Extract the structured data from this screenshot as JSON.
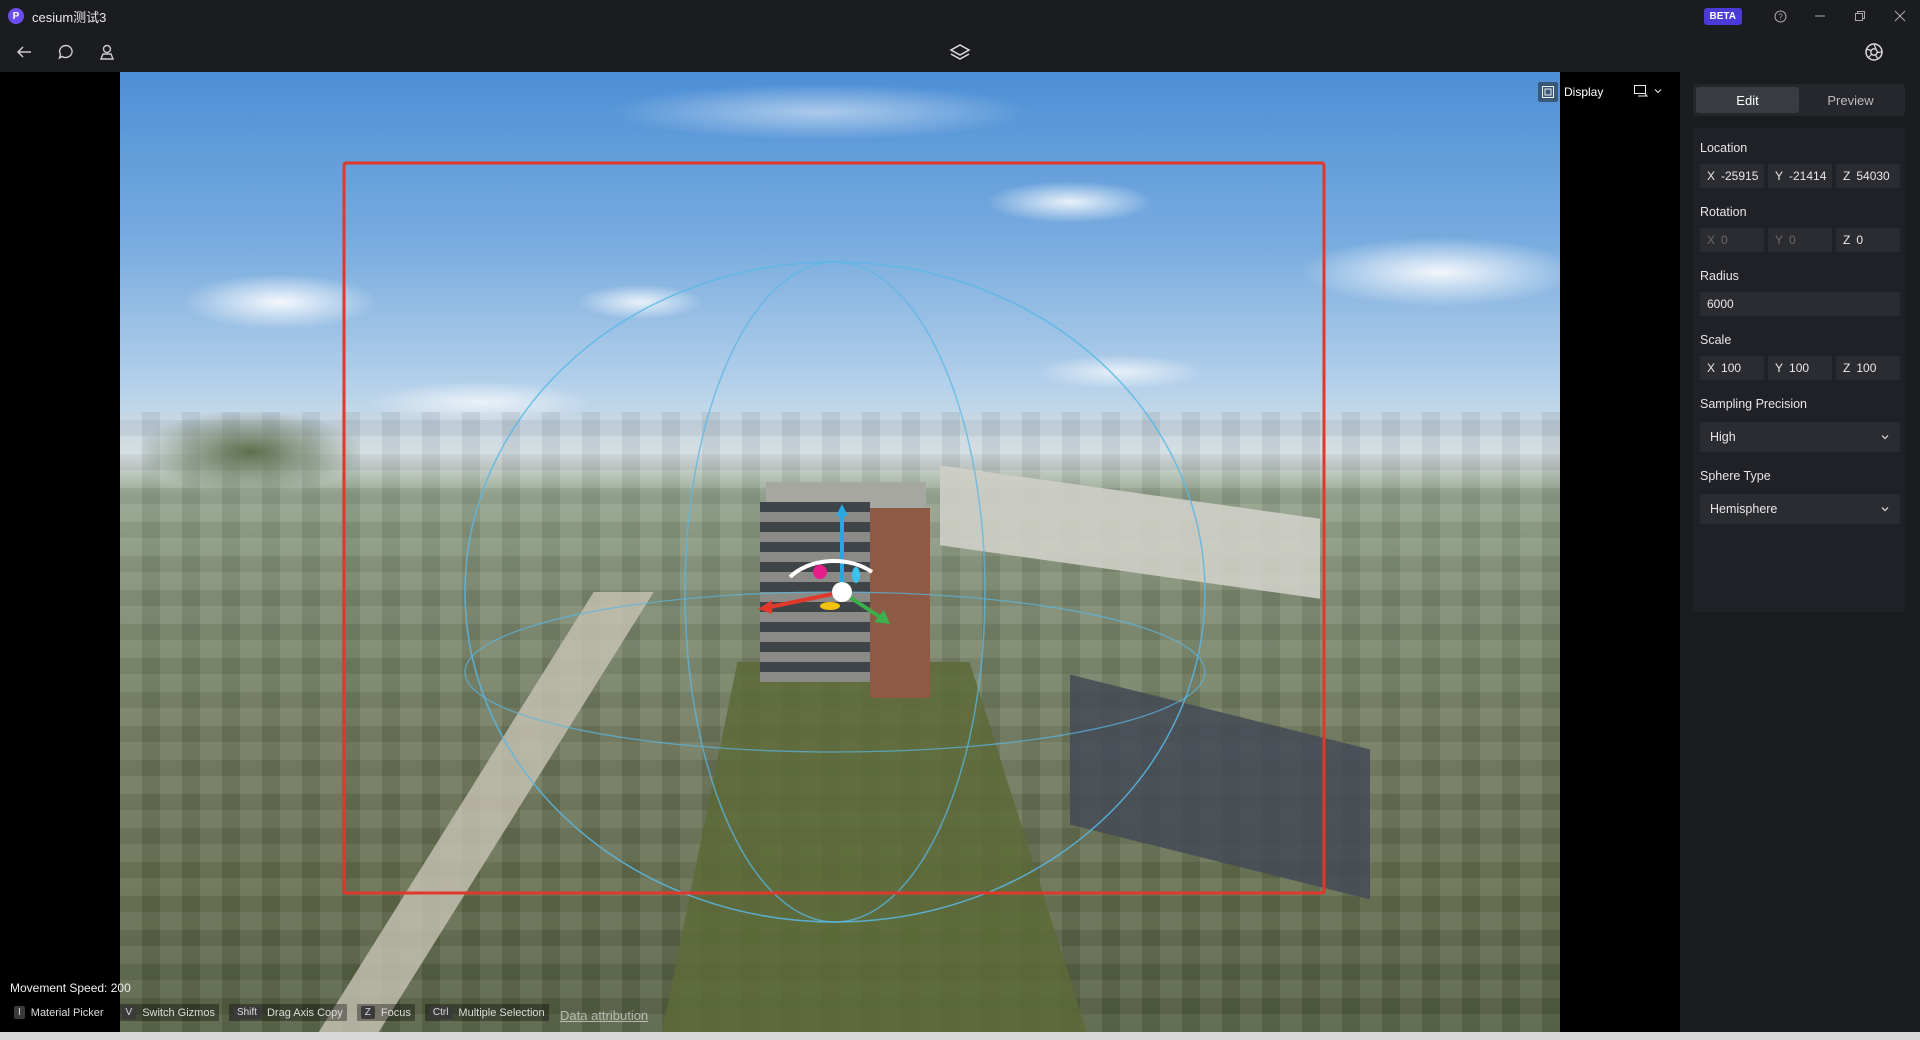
{
  "app": {
    "title": "cesium测试3",
    "logo_letter": "P",
    "beta": "BETA"
  },
  "viewport": {
    "display_label": "Display",
    "movement_speed": "Movement Speed: 200",
    "shortcuts": [
      {
        "key": "I",
        "label": "Material Picker"
      },
      {
        "key": "V",
        "label": "Switch Gizmos"
      },
      {
        "key": "Shift",
        "label": "Drag Axis Copy"
      },
      {
        "key": "Z",
        "label": "Focus"
      },
      {
        "key": "Ctrl",
        "label": "Multiple Selection"
      }
    ],
    "attribution": "Data attribution"
  },
  "panel": {
    "tabs": [
      "Edit",
      "Preview"
    ],
    "active_tab": "Edit",
    "location": {
      "label": "Location",
      "x": "-25915",
      "y": "-21414",
      "z": "54030"
    },
    "rotation": {
      "label": "Rotation",
      "x": "0",
      "y": "0",
      "z": "0"
    },
    "radius": {
      "label": "Radius",
      "value": "6000"
    },
    "scale": {
      "label": "Scale",
      "x": "100",
      "y": "100",
      "z": "100"
    },
    "sampling_precision": {
      "label": "Sampling Precision",
      "value": "High"
    },
    "sphere_type": {
      "label": "Sphere Type",
      "value": "Hemisphere"
    },
    "axis_labels": {
      "x": "X",
      "y": "Y",
      "z": "Z"
    }
  },
  "colors": {
    "accent": "#4b3ad6",
    "selection": "#e0392b",
    "sphere": "#5ab8e6"
  }
}
